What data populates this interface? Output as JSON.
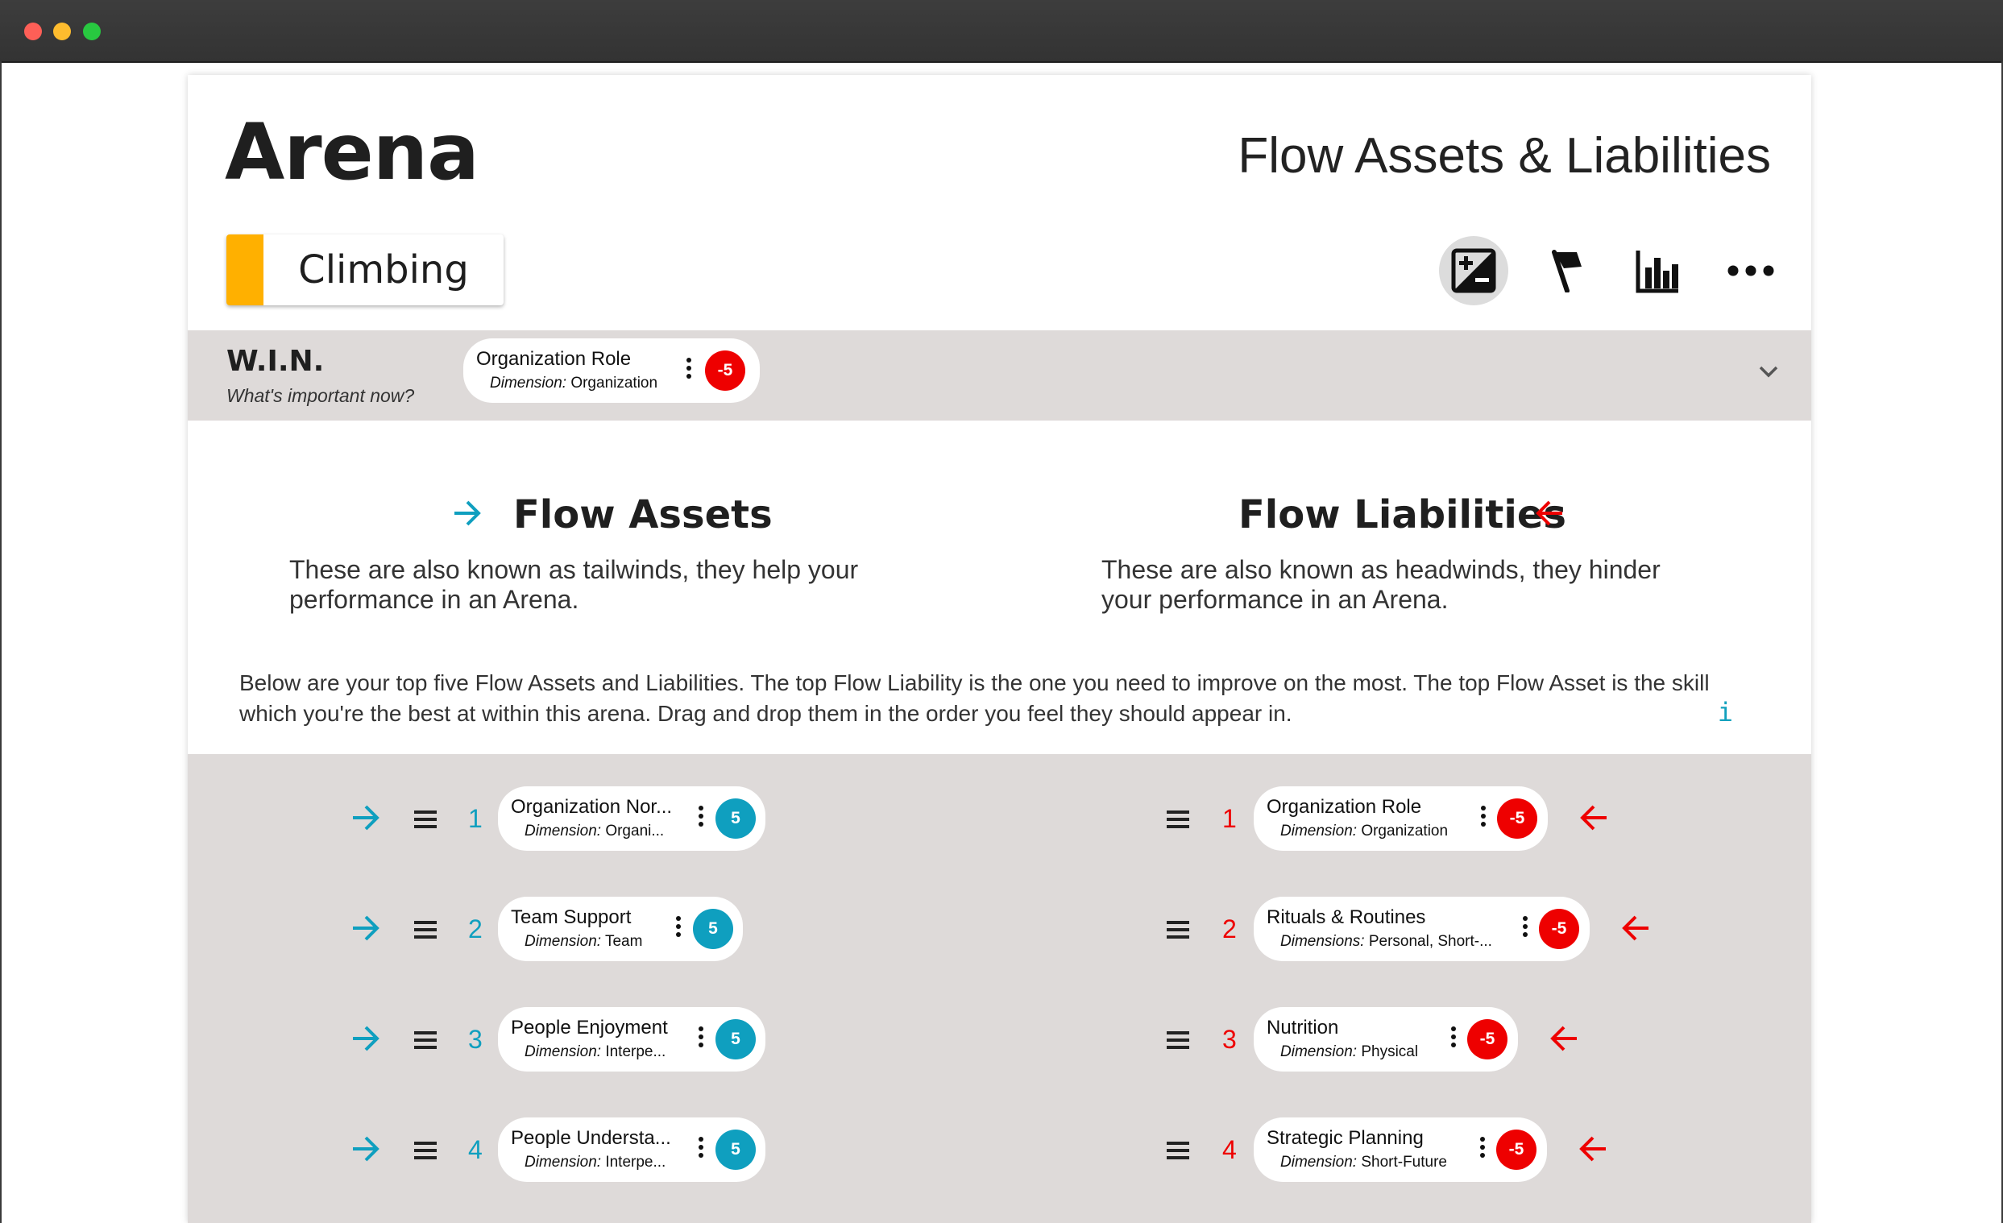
{
  "window": {
    "controls": [
      "close",
      "minimize",
      "maximize"
    ]
  },
  "header": {
    "title": "Arena",
    "page_title": "Flow Assets & Liabilities",
    "status": {
      "label": "Climbing",
      "color": "#ffb000"
    },
    "toolbar": [
      "plus-minus-icon",
      "flag-icon",
      "bar-chart-icon",
      "more-icon"
    ]
  },
  "win": {
    "title": "W.I.N.",
    "subtitle": "What's important now?",
    "item": {
      "name": "Organization Role",
      "dim_label": "Dimension:",
      "dim_value": "Organization",
      "score": "-5"
    }
  },
  "assets": {
    "title": "Flow Assets",
    "description": "These are also known as tailwinds, they help your performance in an Arena.",
    "color": "#0f9fbf",
    "items": [
      {
        "rank": "1",
        "name": "Organization Nor...",
        "dim_label": "Dimension:",
        "dim_value": "Organi...",
        "score": "5"
      },
      {
        "rank": "2",
        "name": "Team Support",
        "dim_label": "Dimension:",
        "dim_value": "Team",
        "score": "5"
      },
      {
        "rank": "3",
        "name": "People Enjoyment",
        "dim_label": "Dimension:",
        "dim_value": "Interpe...",
        "score": "5"
      },
      {
        "rank": "4",
        "name": "People Understa...",
        "dim_label": "Dimension:",
        "dim_value": "Interpe...",
        "score": "5"
      }
    ]
  },
  "liabilities": {
    "title": "Flow Liabilities",
    "description": "These are also known as headwinds, they hinder your performance in an Arena.",
    "color": "#ee0000",
    "items": [
      {
        "rank": "1",
        "name": "Organization Role",
        "dim_label": "Dimension:",
        "dim_value": "Organization",
        "score": "-5"
      },
      {
        "rank": "2",
        "name": "Rituals & Routines",
        "dim_label": "Dimensions:",
        "dim_value": "Personal, Short-...",
        "score": "-5"
      },
      {
        "rank": "3",
        "name": "Nutrition",
        "dim_label": "Dimension:",
        "dim_value": "Physical",
        "score": "-5"
      },
      {
        "rank": "4",
        "name": "Strategic Planning",
        "dim_label": "Dimension:",
        "dim_value": "Short-Future",
        "score": "-5"
      }
    ]
  },
  "intro": "Below are your top five Flow Assets and Liabilities. The top Flow Liability is the one you need to improve on the most. The top Flow Asset is the skill which you're the best at within this arena. Drag and drop them in the order you feel they should appear in.",
  "info_icon": "i"
}
